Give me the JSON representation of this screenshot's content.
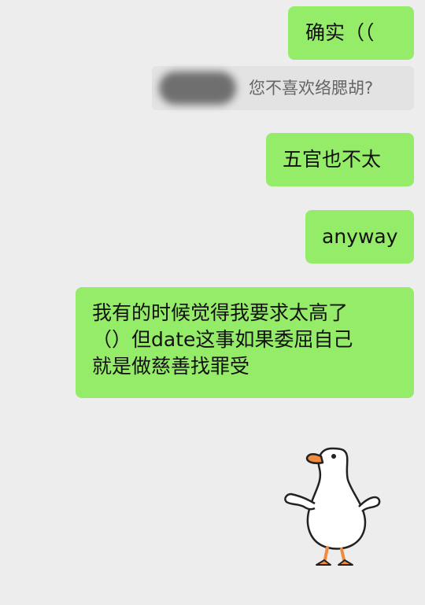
{
  "messages": [
    {
      "text": "确实（（"
    },
    {
      "quote": "您不喜欢络腮胡?"
    },
    {
      "text": "五官也不太"
    },
    {
      "text": "anyway"
    },
    {
      "lines": [
        "我有的时候觉得我要求太高了",
        "（）但date这事如果委屈自己",
        "就是做慈善找罪受"
      ]
    }
  ],
  "colors": {
    "background": "#ededed",
    "sent_bubble": "#95ec69",
    "quote_bubble": "#e3e3e3"
  },
  "sticker": {
    "icon": "white-goose-shrug-sticker"
  }
}
